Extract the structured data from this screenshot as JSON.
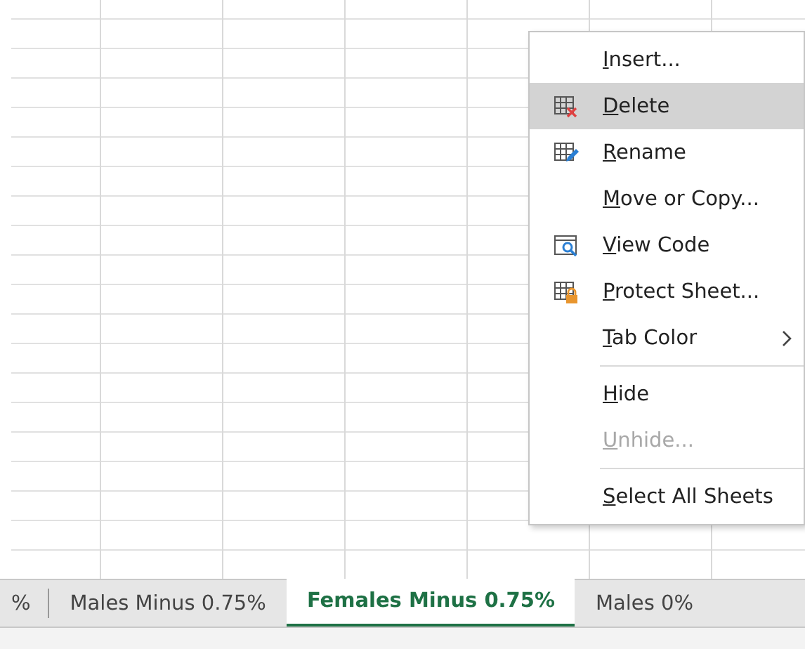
{
  "sheet_tabs": [
    {
      "label": "%",
      "selected": false
    },
    {
      "label": "Males Minus 0.75%",
      "selected": false
    },
    {
      "label": "Females Minus 0.75%",
      "selected": true
    },
    {
      "label": "Males 0%",
      "selected": false
    }
  ],
  "context_menu": {
    "items": [
      {
        "label": "Insert...",
        "kind": "plain",
        "selected": false,
        "disabled": false,
        "submenu": false,
        "separator_before": false
      },
      {
        "label": "Delete",
        "kind": "delete",
        "selected": true,
        "disabled": false,
        "submenu": false,
        "separator_before": false
      },
      {
        "label": "Rename",
        "kind": "rename",
        "selected": false,
        "disabled": false,
        "submenu": false,
        "separator_before": false
      },
      {
        "label": "Move or Copy...",
        "kind": "plain",
        "selected": false,
        "disabled": false,
        "submenu": false,
        "separator_before": false
      },
      {
        "label": "View Code",
        "kind": "code",
        "selected": false,
        "disabled": false,
        "submenu": false,
        "separator_before": false
      },
      {
        "label": "Protect Sheet...",
        "kind": "protect",
        "selected": false,
        "disabled": false,
        "submenu": false,
        "separator_before": false
      },
      {
        "label": "Tab Color",
        "kind": "plain",
        "selected": false,
        "disabled": false,
        "submenu": true,
        "separator_before": false
      },
      {
        "label": "Hide",
        "kind": "plain",
        "selected": false,
        "disabled": false,
        "submenu": false,
        "separator_before": true
      },
      {
        "label": "Unhide...",
        "kind": "plain",
        "selected": false,
        "disabled": true,
        "submenu": false,
        "separator_before": false
      },
      {
        "label": "Select All Sheets",
        "kind": "plain",
        "selected": false,
        "disabled": false,
        "submenu": false,
        "separator_before": true
      }
    ]
  }
}
